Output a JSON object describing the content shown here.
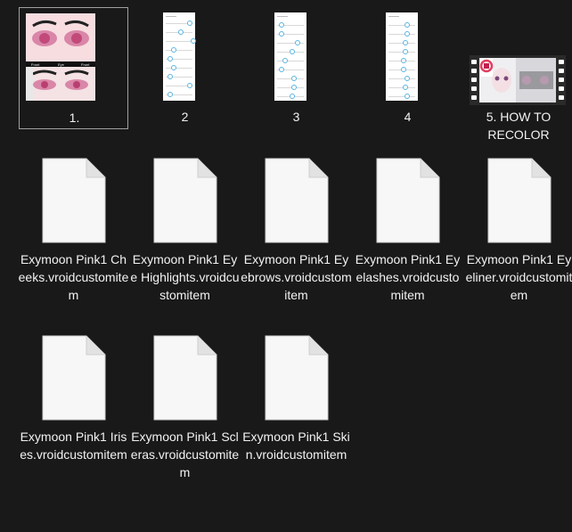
{
  "items": [
    {
      "label": "1.",
      "type": "image",
      "selected": true,
      "thumb_text": [
        "Front",
        "Eye",
        "Front"
      ]
    },
    {
      "label": "2",
      "type": "image"
    },
    {
      "label": "3",
      "type": "image"
    },
    {
      "label": "4",
      "type": "image"
    },
    {
      "label": "5. HOW TO RECOLOR",
      "type": "video"
    },
    {
      "label": "Exymoon Pink1 Cheeks.vroidcustomitem",
      "type": "file"
    },
    {
      "label": "Exymoon Pink1 Eye Highlights.vroidcustomitem",
      "type": "file"
    },
    {
      "label": "Exymoon Pink1 Eyebrows.vroidcustomitem",
      "type": "file"
    },
    {
      "label": "Exymoon Pink1 Eyelashes.vroidcustomitem",
      "type": "file"
    },
    {
      "label": "Exymoon Pink1 Eyeliner.vroidcustomitem",
      "type": "file"
    },
    {
      "label": "Exymoon Pink1 Irises.vroidcustomitem",
      "type": "file"
    },
    {
      "label": "Exymoon Pink1 Scleras.vroidcustomitem",
      "type": "file"
    },
    {
      "label": "Exymoon Pink1 Skin.vroidcustomitem",
      "type": "file"
    }
  ],
  "colors": {
    "background": "#191919",
    "selection_border": "#a0a0a0",
    "slider_accent": "#5ab4e0"
  }
}
